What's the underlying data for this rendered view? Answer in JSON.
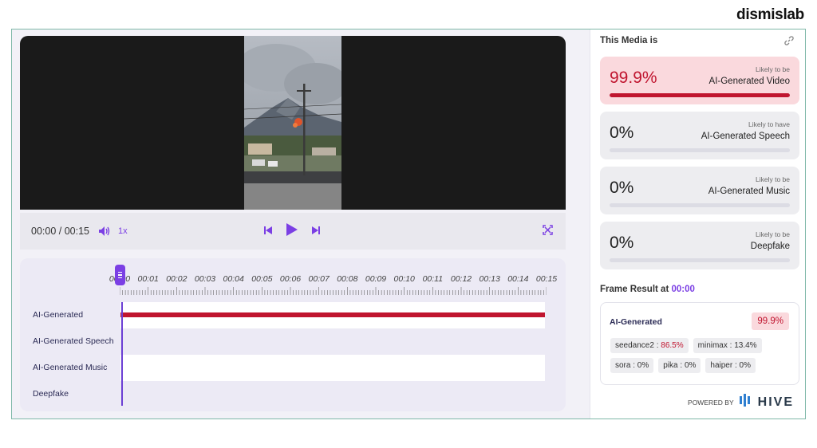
{
  "brand": {
    "name": "dismislab"
  },
  "player": {
    "time": "00:00 / 00:15",
    "speed": "1x"
  },
  "timeline": {
    "ticks": [
      "00:00",
      "00:01",
      "00:02",
      "00:03",
      "00:04",
      "00:05",
      "00:06",
      "00:07",
      "00:08",
      "00:09",
      "00:10",
      "00:11",
      "00:12",
      "00:13",
      "00:14",
      "00:15"
    ],
    "tracks": [
      {
        "label": "AI-Generated",
        "fill": 1.0
      },
      {
        "label": "AI-Generated Speech",
        "fill": 0
      },
      {
        "label": "AI-Generated Music",
        "fill": 0
      },
      {
        "label": "Deepfake",
        "fill": 0
      }
    ]
  },
  "panel": {
    "title": "This Media is",
    "cards": [
      {
        "pct": "99.9%",
        "small": "Likely to be",
        "big": "AI-Generated Video",
        "fill": 0.999
      },
      {
        "pct": "0%",
        "small": "Likely to have",
        "big": "AI-Generated Speech",
        "fill": 0
      },
      {
        "pct": "0%",
        "small": "Likely to be",
        "big": "AI-Generated Music",
        "fill": 0
      },
      {
        "pct": "0%",
        "small": "Likely to be",
        "big": "Deepfake",
        "fill": 0
      }
    ],
    "frame_result_label": "Frame Result at",
    "frame_result_time": "00:00",
    "result": {
      "head": "AI-Generated",
      "badge": "99.9%",
      "chips": [
        {
          "name": "seedance2 :",
          "value": "86.5%",
          "highlight": true
        },
        {
          "name": "minimax :",
          "value": "13.4%",
          "highlight": false
        },
        {
          "name": "sora :",
          "value": "0%",
          "highlight": false
        },
        {
          "name": "pika :",
          "value": "0%",
          "highlight": false
        },
        {
          "name": "haiper :",
          "value": "0%",
          "highlight": false
        }
      ]
    },
    "powered_by": "POWERED BY",
    "hive": "HIVE"
  },
  "colors": {
    "accent": "#7b3fe4",
    "danger": "#c0152f"
  },
  "icons": [
    "volume-icon",
    "prev-icon",
    "play-icon",
    "next-icon",
    "expand-icon",
    "link-icon",
    "hive-logo-icon"
  ]
}
